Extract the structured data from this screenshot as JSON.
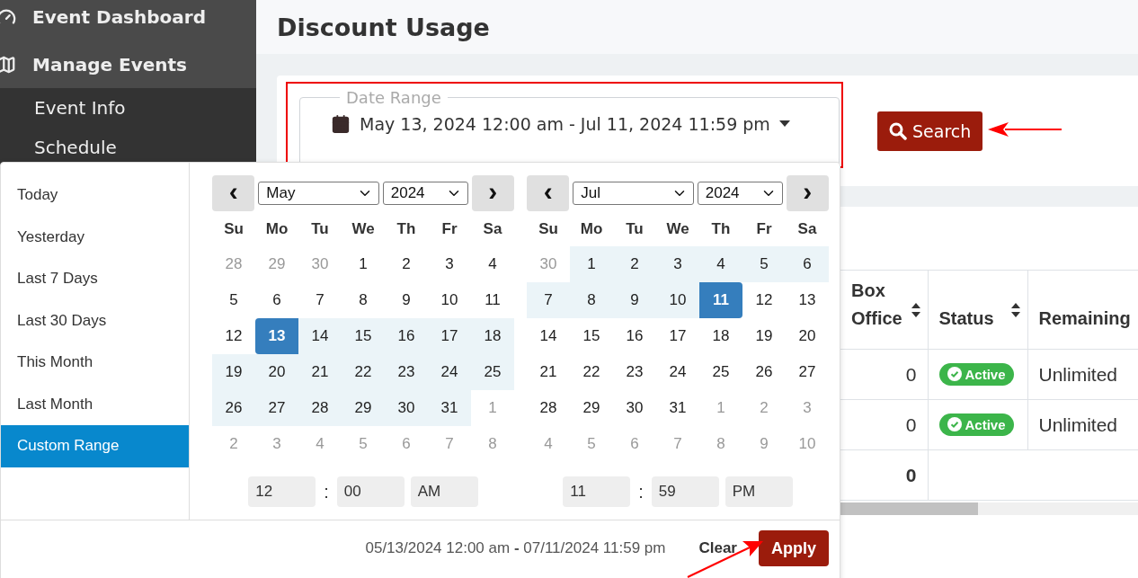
{
  "sidebar": {
    "items": [
      {
        "label": "Event Dashboard"
      },
      {
        "label": "Manage Events",
        "children": [
          {
            "label": "Event Info"
          },
          {
            "label": "Schedule"
          }
        ]
      }
    ]
  },
  "page_title": "Discount Usage",
  "filter": {
    "date_range": {
      "label": "Date Range",
      "value": "May 13, 2024 12:00 am - Jul 11, 2024 11:59 pm"
    },
    "search_button": "Search"
  },
  "table": {
    "columns": [
      {
        "label": "Box Office",
        "sortable": true
      },
      {
        "label": "Status",
        "sortable": true
      },
      {
        "label": "Remaining",
        "sortable": false
      }
    ],
    "rows": [
      {
        "box_office": "0",
        "status": "Active",
        "remaining": "Unlimited"
      },
      {
        "box_office": "0",
        "status": "Active",
        "remaining": "Unlimited"
      }
    ],
    "total": "0"
  },
  "datepicker": {
    "ranges": [
      {
        "label": "Today",
        "selected": false
      },
      {
        "label": "Yesterday",
        "selected": false
      },
      {
        "label": "Last 7 Days",
        "selected": false
      },
      {
        "label": "Last 30 Days",
        "selected": false
      },
      {
        "label": "This Month",
        "selected": false
      },
      {
        "label": "Last Month",
        "selected": false
      },
      {
        "label": "Custom Range",
        "selected": true
      }
    ],
    "calendars": [
      {
        "month": "May",
        "year": "2024",
        "prev": "‹",
        "next": "›",
        "weekdays": [
          "Su",
          "Mo",
          "Tu",
          "We",
          "Th",
          "Fr",
          "Sa"
        ],
        "time": {
          "hour": "12",
          "separator": ":",
          "minute": "00",
          "ampm": "AM"
        },
        "weeks": [
          [
            {
              "d": "28",
              "off": true,
              "in_range": false,
              "selected": false
            },
            {
              "d": "29",
              "off": true,
              "in_range": false,
              "selected": false
            },
            {
              "d": "30",
              "off": true,
              "in_range": false,
              "selected": false
            },
            {
              "d": "1",
              "off": false,
              "in_range": false,
              "selected": false
            },
            {
              "d": "2",
              "off": false,
              "in_range": false,
              "selected": false
            },
            {
              "d": "3",
              "off": false,
              "in_range": false,
              "selected": false
            },
            {
              "d": "4",
              "off": false,
              "in_range": false,
              "selected": false
            }
          ],
          [
            {
              "d": "5",
              "off": false,
              "in_range": false,
              "selected": false
            },
            {
              "d": "6",
              "off": false,
              "in_range": false,
              "selected": false
            },
            {
              "d": "7",
              "off": false,
              "in_range": false,
              "selected": false
            },
            {
              "d": "8",
              "off": false,
              "in_range": false,
              "selected": false
            },
            {
              "d": "9",
              "off": false,
              "in_range": false,
              "selected": false
            },
            {
              "d": "10",
              "off": false,
              "in_range": false,
              "selected": false
            },
            {
              "d": "11",
              "off": false,
              "in_range": false,
              "selected": false
            }
          ],
          [
            {
              "d": "12",
              "off": false,
              "in_range": false,
              "selected": false
            },
            {
              "d": "13",
              "off": false,
              "in_range": true,
              "selected": true
            },
            {
              "d": "14",
              "off": false,
              "in_range": true,
              "selected": false
            },
            {
              "d": "15",
              "off": false,
              "in_range": true,
              "selected": false
            },
            {
              "d": "16",
              "off": false,
              "in_range": true,
              "selected": false
            },
            {
              "d": "17",
              "off": false,
              "in_range": true,
              "selected": false
            },
            {
              "d": "18",
              "off": false,
              "in_range": true,
              "selected": false
            }
          ],
          [
            {
              "d": "19",
              "off": false,
              "in_range": true,
              "selected": false
            },
            {
              "d": "20",
              "off": false,
              "in_range": true,
              "selected": false
            },
            {
              "d": "21",
              "off": false,
              "in_range": true,
              "selected": false
            },
            {
              "d": "22",
              "off": false,
              "in_range": true,
              "selected": false
            },
            {
              "d": "23",
              "off": false,
              "in_range": true,
              "selected": false
            },
            {
              "d": "24",
              "off": false,
              "in_range": true,
              "selected": false
            },
            {
              "d": "25",
              "off": false,
              "in_range": true,
              "selected": false
            }
          ],
          [
            {
              "d": "26",
              "off": false,
              "in_range": true,
              "selected": false
            },
            {
              "d": "27",
              "off": false,
              "in_range": true,
              "selected": false
            },
            {
              "d": "28",
              "off": false,
              "in_range": true,
              "selected": false
            },
            {
              "d": "29",
              "off": false,
              "in_range": true,
              "selected": false
            },
            {
              "d": "30",
              "off": false,
              "in_range": true,
              "selected": false
            },
            {
              "d": "31",
              "off": false,
              "in_range": true,
              "selected": false
            },
            {
              "d": "1",
              "off": true,
              "in_range": false,
              "selected": false
            }
          ],
          [
            {
              "d": "2",
              "off": true,
              "in_range": false,
              "selected": false
            },
            {
              "d": "3",
              "off": true,
              "in_range": false,
              "selected": false
            },
            {
              "d": "4",
              "off": true,
              "in_range": false,
              "selected": false
            },
            {
              "d": "5",
              "off": true,
              "in_range": false,
              "selected": false
            },
            {
              "d": "6",
              "off": true,
              "in_range": false,
              "selected": false
            },
            {
              "d": "7",
              "off": true,
              "in_range": false,
              "selected": false
            },
            {
              "d": "8",
              "off": true,
              "in_range": false,
              "selected": false
            }
          ]
        ]
      },
      {
        "month": "Jul",
        "year": "2024",
        "prev": "‹",
        "next": "›",
        "weekdays": [
          "Su",
          "Mo",
          "Tu",
          "We",
          "Th",
          "Fr",
          "Sa"
        ],
        "time": {
          "hour": "11",
          "separator": ":",
          "minute": "59",
          "ampm": "PM"
        },
        "weeks": [
          [
            {
              "d": "30",
              "off": true,
              "in_range": false,
              "selected": false
            },
            {
              "d": "1",
              "off": false,
              "in_range": true,
              "selected": false
            },
            {
              "d": "2",
              "off": false,
              "in_range": true,
              "selected": false
            },
            {
              "d": "3",
              "off": false,
              "in_range": true,
              "selected": false
            },
            {
              "d": "4",
              "off": false,
              "in_range": true,
              "selected": false
            },
            {
              "d": "5",
              "off": false,
              "in_range": true,
              "selected": false
            },
            {
              "d": "6",
              "off": false,
              "in_range": true,
              "selected": false
            }
          ],
          [
            {
              "d": "7",
              "off": false,
              "in_range": true,
              "selected": false
            },
            {
              "d": "8",
              "off": false,
              "in_range": true,
              "selected": false
            },
            {
              "d": "9",
              "off": false,
              "in_range": true,
              "selected": false
            },
            {
              "d": "10",
              "off": false,
              "in_range": true,
              "selected": false
            },
            {
              "d": "11",
              "off": false,
              "in_range": true,
              "selected": true
            },
            {
              "d": "12",
              "off": false,
              "in_range": false,
              "selected": false
            },
            {
              "d": "13",
              "off": false,
              "in_range": false,
              "selected": false
            }
          ],
          [
            {
              "d": "14",
              "off": false,
              "in_range": false,
              "selected": false
            },
            {
              "d": "15",
              "off": false,
              "in_range": false,
              "selected": false
            },
            {
              "d": "16",
              "off": false,
              "in_range": false,
              "selected": false
            },
            {
              "d": "17",
              "off": false,
              "in_range": false,
              "selected": false
            },
            {
              "d": "18",
              "off": false,
              "in_range": false,
              "selected": false
            },
            {
              "d": "19",
              "off": false,
              "in_range": false,
              "selected": false
            },
            {
              "d": "20",
              "off": false,
              "in_range": false,
              "selected": false
            }
          ],
          [
            {
              "d": "21",
              "off": false,
              "in_range": false,
              "selected": false
            },
            {
              "d": "22",
              "off": false,
              "in_range": false,
              "selected": false
            },
            {
              "d": "23",
              "off": false,
              "in_range": false,
              "selected": false
            },
            {
              "d": "24",
              "off": false,
              "in_range": false,
              "selected": false
            },
            {
              "d": "25",
              "off": false,
              "in_range": false,
              "selected": false
            },
            {
              "d": "26",
              "off": false,
              "in_range": false,
              "selected": false
            },
            {
              "d": "27",
              "off": false,
              "in_range": false,
              "selected": false
            }
          ],
          [
            {
              "d": "28",
              "off": false,
              "in_range": false,
              "selected": false
            },
            {
              "d": "29",
              "off": false,
              "in_range": false,
              "selected": false
            },
            {
              "d": "30",
              "off": false,
              "in_range": false,
              "selected": false
            },
            {
              "d": "31",
              "off": false,
              "in_range": false,
              "selected": false
            },
            {
              "d": "1",
              "off": true,
              "in_range": false,
              "selected": false
            },
            {
              "d": "2",
              "off": true,
              "in_range": false,
              "selected": false
            },
            {
              "d": "3",
              "off": true,
              "in_range": false,
              "selected": false
            }
          ],
          [
            {
              "d": "4",
              "off": true,
              "in_range": false,
              "selected": false
            },
            {
              "d": "5",
              "off": true,
              "in_range": false,
              "selected": false
            },
            {
              "d": "6",
              "off": true,
              "in_range": false,
              "selected": false
            },
            {
              "d": "7",
              "off": true,
              "in_range": false,
              "selected": false
            },
            {
              "d": "8",
              "off": true,
              "in_range": false,
              "selected": false
            },
            {
              "d": "9",
              "off": true,
              "in_range": false,
              "selected": false
            },
            {
              "d": "10",
              "off": true,
              "in_range": false,
              "selected": false
            }
          ]
        ]
      }
    ],
    "summary": "05/13/2024 12:00 am **-** 07/11/2024 11:59 pm",
    "clear_button": "Clear",
    "apply_button": "Apply"
  }
}
